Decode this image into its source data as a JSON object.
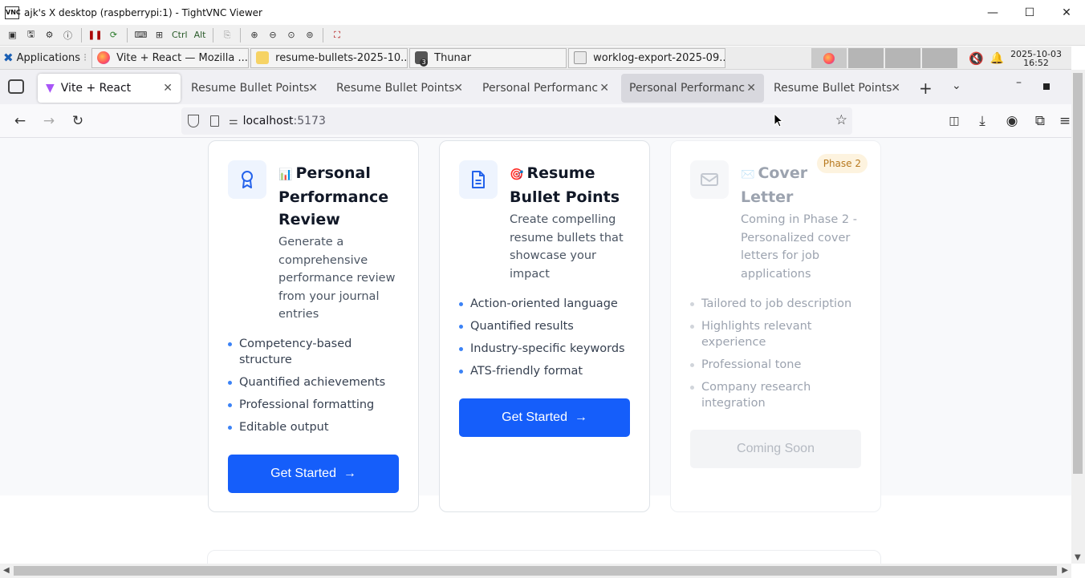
{
  "vnc": {
    "title": "ajk's X desktop (raspberrypi:1) - TightVNC Viewer",
    "logo_text": "VNC",
    "toolbar_ctrl": "Ctrl",
    "toolbar_alt": "Alt"
  },
  "panel": {
    "applications_label": "Applications",
    "tasks": [
      {
        "label": "Vite + React — Mozilla ...",
        "icon": "firefox-icon"
      },
      {
        "label": "resume-bullets-2025-10...",
        "icon": "file-icon"
      },
      {
        "label": "Thunar",
        "icon": "folder-icon",
        "badge": "3"
      },
      {
        "label": "worklog-export-2025-09...",
        "icon": "spreadsheet-icon"
      }
    ],
    "clock_date": "2025-10-03",
    "clock_time": "16:52"
  },
  "browser": {
    "tabs": [
      {
        "label": "Vite + React"
      },
      {
        "label": "Resume Bullet Points"
      },
      {
        "label": "Resume Bullet Points"
      },
      {
        "label": "Personal Performance"
      },
      {
        "label": "Personal Performance"
      },
      {
        "label": "Resume Bullet Points"
      }
    ],
    "url_host": "localhost",
    "url_port": ":5173"
  },
  "cards": [
    {
      "emoji": "📊",
      "title": "Personal Performance Review",
      "description": "Generate a comprehensive performance review from your journal entries",
      "features": [
        "Competency-based structure",
        "Quantified achievements",
        "Professional formatting",
        "Editable output"
      ],
      "button": "Get Started",
      "button_arrow": "→"
    },
    {
      "emoji": "🎯",
      "title": "Resume Bullet Points",
      "description": "Create compelling resume bullets that showcase your impact",
      "features": [
        "Action-oriented language",
        "Quantified results",
        "Industry-specific keywords",
        "ATS-friendly format"
      ],
      "button": "Get Started",
      "button_arrow": "→"
    },
    {
      "emoji": "✉️",
      "title": "Cover Letter",
      "badge": "Phase 2",
      "description": "Coming in Phase 2 - Personalized cover letters for job applications",
      "features": [
        "Tailored to job description",
        "Highlights relevant experience",
        "Professional tone",
        "Company research integration"
      ],
      "button": "Coming Soon"
    }
  ],
  "colors": {
    "primary_button": "#155efa",
    "icon_blue": "#2563eb",
    "badge_bg": "#fdf3df",
    "badge_text": "#b7791f"
  }
}
